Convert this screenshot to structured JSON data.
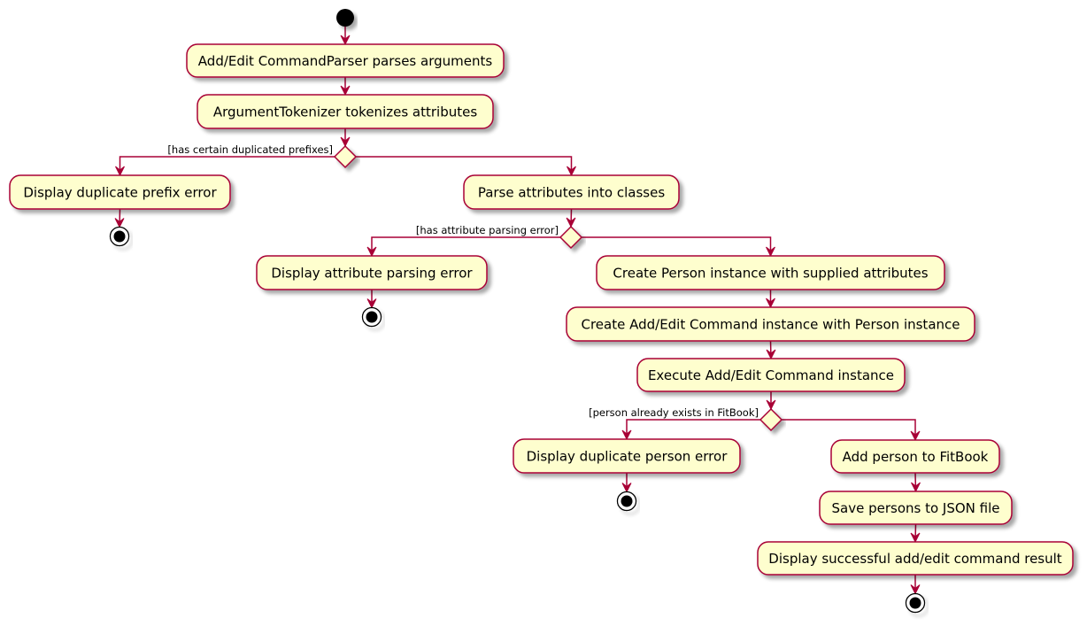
{
  "diagram": {
    "type": "activity",
    "colors": {
      "node_fill": "#FEFECE",
      "node_border": "#A80036",
      "edge": "#A80036",
      "text": "#000000",
      "start_end": "#000000",
      "background": "#FFFFFF"
    },
    "nodes": [
      {
        "id": "start",
        "kind": "start"
      },
      {
        "id": "parse_args",
        "kind": "action",
        "label": "Add/Edit CommandParser parses arguments"
      },
      {
        "id": "tokenize",
        "kind": "action",
        "label": "ArgumentTokenizer tokenizes attributes"
      },
      {
        "id": "dec_prefix",
        "kind": "decision"
      },
      {
        "id": "dup_prefix_err",
        "kind": "action",
        "label": "Display duplicate prefix error"
      },
      {
        "id": "end_prefix",
        "kind": "end"
      },
      {
        "id": "parse_attrs",
        "kind": "action",
        "label": "Parse attributes into classes"
      },
      {
        "id": "dec_attr",
        "kind": "decision"
      },
      {
        "id": "attr_err",
        "kind": "action",
        "label": "Display attribute parsing error"
      },
      {
        "id": "end_attr",
        "kind": "end"
      },
      {
        "id": "create_person",
        "kind": "action",
        "label": "Create Person instance with supplied attributes"
      },
      {
        "id": "create_cmd",
        "kind": "action",
        "label": "Create Add/Edit Command instance with Person instance"
      },
      {
        "id": "execute_cmd",
        "kind": "action",
        "label": "Execute Add/Edit Command instance"
      },
      {
        "id": "dec_person",
        "kind": "decision"
      },
      {
        "id": "dup_person_err",
        "kind": "action",
        "label": "Display duplicate person error"
      },
      {
        "id": "end_person",
        "kind": "end"
      },
      {
        "id": "add_person",
        "kind": "action",
        "label": "Add person to FitBook"
      },
      {
        "id": "save_json",
        "kind": "action",
        "label": "Save persons to JSON file"
      },
      {
        "id": "display_success",
        "kind": "action",
        "label": "Display successful add/edit command result"
      },
      {
        "id": "end_success",
        "kind": "end"
      }
    ],
    "edges": [
      {
        "from": "start",
        "to": "parse_args"
      },
      {
        "from": "parse_args",
        "to": "tokenize"
      },
      {
        "from": "tokenize",
        "to": "dec_prefix"
      },
      {
        "from": "dec_prefix",
        "to": "dup_prefix_err",
        "guard": "[has certain duplicated prefixes]"
      },
      {
        "from": "dec_prefix",
        "to": "parse_attrs"
      },
      {
        "from": "dup_prefix_err",
        "to": "end_prefix"
      },
      {
        "from": "parse_attrs",
        "to": "dec_attr"
      },
      {
        "from": "dec_attr",
        "to": "attr_err",
        "guard": "[has attribute parsing error]"
      },
      {
        "from": "dec_attr",
        "to": "create_person"
      },
      {
        "from": "attr_err",
        "to": "end_attr"
      },
      {
        "from": "create_person",
        "to": "create_cmd"
      },
      {
        "from": "create_cmd",
        "to": "execute_cmd"
      },
      {
        "from": "execute_cmd",
        "to": "dec_person"
      },
      {
        "from": "dec_person",
        "to": "dup_person_err",
        "guard": "[person already exists in FitBook]"
      },
      {
        "from": "dec_person",
        "to": "add_person"
      },
      {
        "from": "dup_person_err",
        "to": "end_person"
      },
      {
        "from": "add_person",
        "to": "save_json"
      },
      {
        "from": "save_json",
        "to": "display_success"
      },
      {
        "from": "display_success",
        "to": "end_success"
      }
    ]
  }
}
